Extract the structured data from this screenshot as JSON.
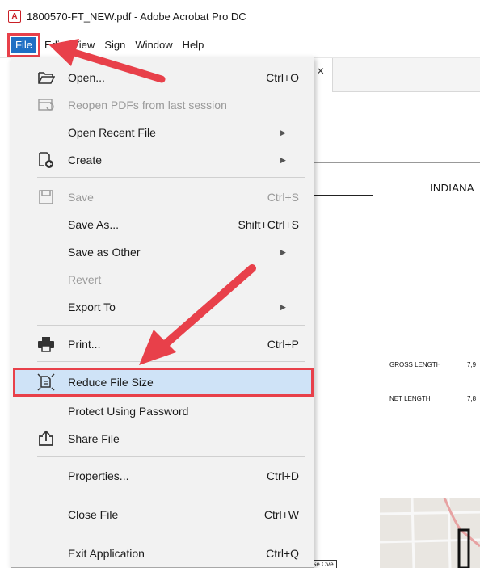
{
  "window": {
    "title": "1800570-FT_NEW.pdf - Adobe Acrobat Pro DC",
    "logo_text": "A"
  },
  "menubar": {
    "items": [
      "File",
      "Edit",
      "View",
      "Sign",
      "Window",
      "Help"
    ]
  },
  "tab": {
    "close": "×"
  },
  "file_menu": {
    "items": [
      {
        "label": "Open...",
        "shortcut": "Ctrl+O",
        "icon": "folder-open-icon",
        "enabled": true
      },
      {
        "label": "Reopen PDFs from last session",
        "shortcut": "",
        "icon": "reopen-pdfs-icon",
        "enabled": false
      },
      {
        "label": "Open Recent File",
        "shortcut": "",
        "submenu": true,
        "enabled": true
      },
      {
        "label": "Create",
        "shortcut": "",
        "icon": "create-pdf-icon",
        "submenu": true,
        "enabled": true
      },
      {
        "label": "Save",
        "shortcut": "Ctrl+S",
        "icon": "save-icon",
        "enabled": false
      },
      {
        "label": "Save As...",
        "shortcut": "Shift+Ctrl+S",
        "enabled": true
      },
      {
        "label": "Save as Other",
        "shortcut": "",
        "submenu": true,
        "enabled": true
      },
      {
        "label": "Revert",
        "shortcut": "",
        "enabled": false
      },
      {
        "label": "Export To",
        "shortcut": "",
        "submenu": true,
        "enabled": true
      },
      {
        "label": "Print...",
        "shortcut": "Ctrl+P",
        "icon": "printer-icon",
        "enabled": true
      },
      {
        "label": "Reduce File Size",
        "shortcut": "",
        "icon": "reduce-file-size-icon",
        "enabled": true,
        "highlighted": true
      },
      {
        "label": "Protect Using Password",
        "shortcut": "",
        "enabled": true
      },
      {
        "label": "Share File",
        "shortcut": "",
        "icon": "share-icon",
        "enabled": true
      },
      {
        "label": "Properties...",
        "shortcut": "Ctrl+D",
        "enabled": true
      },
      {
        "label": "Close File",
        "shortcut": "Ctrl+W",
        "enabled": true
      },
      {
        "label": "Exit Application",
        "shortcut": "Ctrl+Q",
        "enabled": true
      }
    ],
    "submenu_arrow": "▶"
  },
  "document": {
    "heading": "INDIANA",
    "gross_label": "GROSS LENGTH",
    "gross_value": "7,9",
    "net_label": "NET LENGTH",
    "net_value": "7,8",
    "caption": "Se Ove"
  },
  "colors": {
    "accent": "#1f6fc4",
    "annotation": "#e8404a",
    "highlight": "#cfe3f7",
    "pdf_red": "#c91f26"
  }
}
